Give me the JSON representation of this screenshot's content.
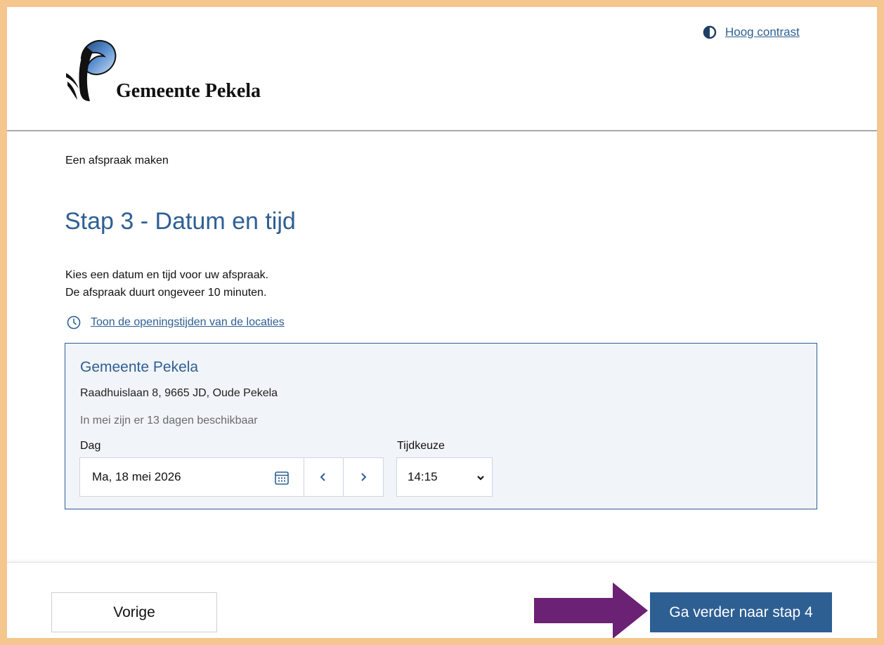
{
  "colors": {
    "brand_blue": "#2e5f93",
    "frame_orange": "#f5c68d",
    "panel_bg": "#f1f4f9",
    "arrow_purple": "#6b2174"
  },
  "header": {
    "logo_text": "Gemeente Pekela",
    "contrast_icon": "half-circle-contrast-icon",
    "contrast_link": "Hoog contrast"
  },
  "breadcrumb": "Een afspraak maken",
  "page_title": "Stap 3 - Datum en tijd",
  "intro": {
    "line1": "Kies een datum en tijd voor uw afspraak.",
    "line2": "De afspraak duurt ongeveer 10 minuten."
  },
  "opening_hours": {
    "icon": "clock-icon",
    "link": "Toon de openingstijden van de locaties"
  },
  "location": {
    "name": "Gemeente Pekela",
    "address": "Raadhuislaan 8, 9665 JD, Oude Pekela",
    "availability": "In mei zijn er 13 dagen beschikbaar",
    "day_label": "Dag",
    "day_value": "Ma, 18 mei 2026",
    "calendar_icon": "calendar-icon",
    "prev_icon": "chevron-left-icon",
    "next_icon": "chevron-right-icon",
    "time_label": "Tijdkeuze",
    "time_value": "14:15",
    "time_dropdown_icon": "chevron-down-icon"
  },
  "footer": {
    "prev_label": "Vorige",
    "next_label": "Ga verder naar stap 4",
    "annotation_arrow": "arrow-right-icon"
  }
}
